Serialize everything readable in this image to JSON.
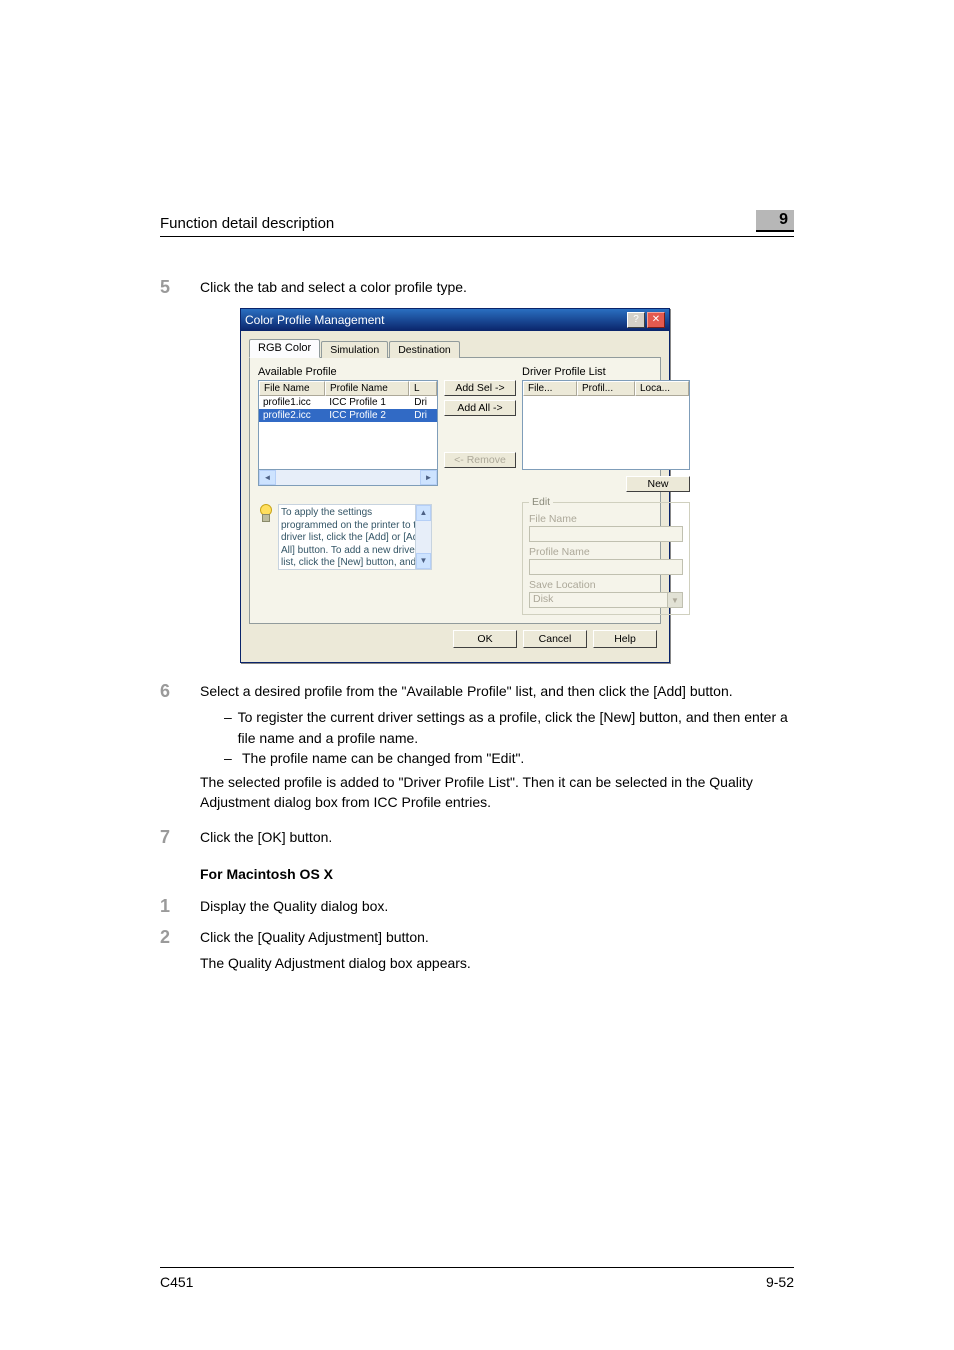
{
  "header": {
    "title": "Function detail description",
    "chapter": "9"
  },
  "steps": {
    "s5": {
      "num": "5",
      "text": "Click the tab and select a color profile type."
    },
    "s6": {
      "num": "6",
      "text": "Select a desired profile from the \"Available Profile\" list, and then click the [Add] button.",
      "bullets": [
        "To register the current driver settings as a profile, click the [New] button, and then enter a file name and a profile name.",
        "The profile name can be changed from \"Edit\"."
      ],
      "after": "The selected profile is added to \"Driver Profile List\". Then it can be selected in the Quality Adjustment dialog box from ICC Profile entries."
    },
    "s7": {
      "num": "7",
      "text": "Click the [OK] button."
    }
  },
  "mac": {
    "heading": "For Macintosh OS X",
    "s1": {
      "num": "1",
      "text": "Display the Quality dialog box."
    },
    "s2": {
      "num": "2",
      "text": "Click the [Quality Adjustment] button.",
      "after": "The Quality Adjustment dialog box appears."
    }
  },
  "footer": {
    "left": "C451",
    "right": "9-52"
  },
  "dialog": {
    "title": "Color Profile Management",
    "help_btn": "?",
    "close_btn": "✕",
    "tabs": [
      "RGB Color",
      "Simulation",
      "Destination"
    ],
    "available_label": "Available Profile",
    "driver_list_label": "Driver Profile List",
    "left_headers": [
      "File Name",
      "Profile Name",
      "L"
    ],
    "left_rows": [
      {
        "file": "profile1.icc",
        "name": "ICC Profile 1",
        "loc": "Dri"
      },
      {
        "file": "profile2.icc",
        "name": "ICC Profile 2",
        "loc": "Dri"
      }
    ],
    "right_headers": [
      "File...",
      "Profil...",
      "Loca..."
    ],
    "btn_add_sel": "Add Sel ->",
    "btn_add_all": "Add All ->",
    "btn_remove": "<- Remove",
    "btn_new": "New",
    "edit_group": "Edit",
    "field_file_name": "File Name",
    "field_profile_name": "Profile Name",
    "field_save_location": "Save Location",
    "save_location_value": "Disk",
    "tip_text": "To apply the settings programmed on the printer to the driver list, click the [Add] or [Add All] button. To add a new driver list, click the [New] button, and then type",
    "ok": "OK",
    "cancel": "Cancel",
    "help": "Help",
    "scroll_left": "◄",
    "scroll_right": "►",
    "scroll_up": "▲",
    "scroll_down": "▼",
    "combo_arrow": "▼"
  }
}
